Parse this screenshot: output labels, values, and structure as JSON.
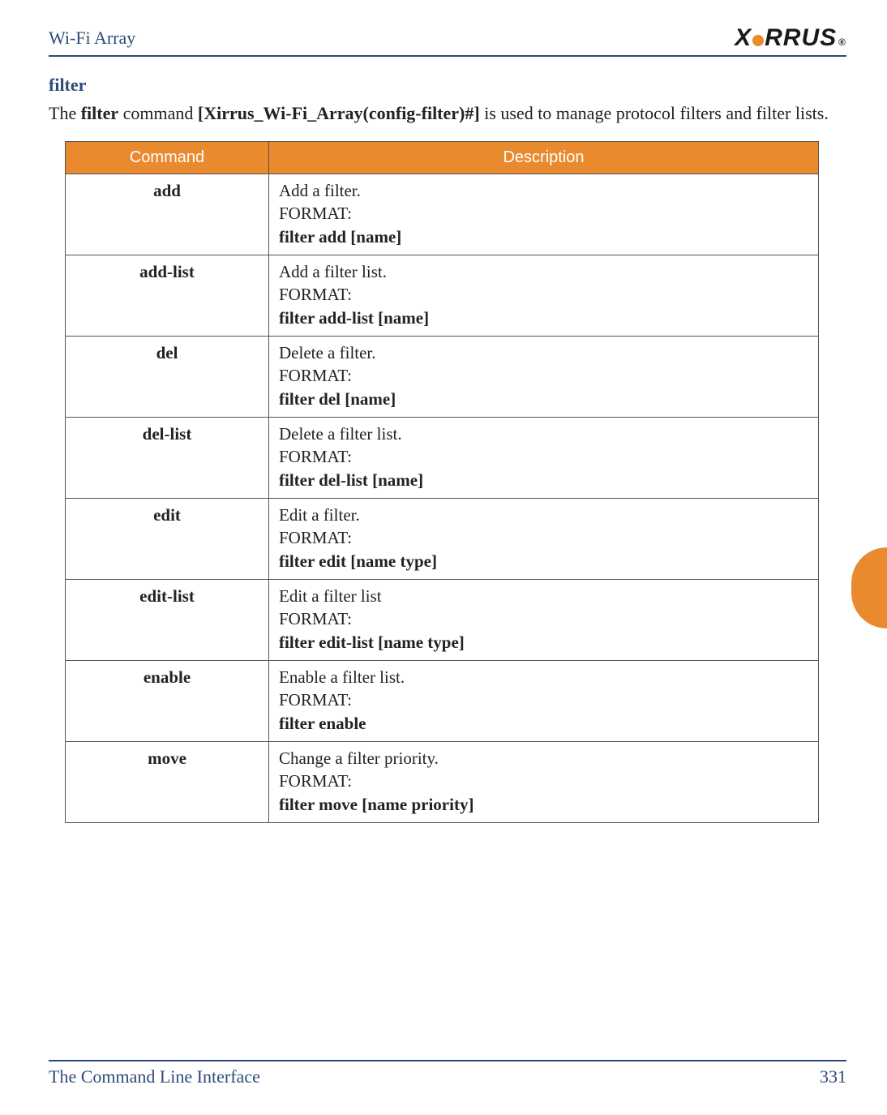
{
  "header": {
    "running_title": "Wi-Fi Array",
    "logo_text_left": "X",
    "logo_text_right": "RRUS",
    "logo_reg": "®"
  },
  "section": {
    "title": "filter",
    "intro_pre": "The ",
    "intro_bold1": "filter",
    "intro_mid": " command ",
    "intro_bold2": "[Xirrus_Wi-Fi_Array(config-filter)#]",
    "intro_post": " is used to manage protocol filters and filter lists."
  },
  "table": {
    "headers": {
      "command": "Command",
      "description": "Description"
    },
    "rows": [
      {
        "cmd": "add",
        "desc": "Add a filter.",
        "format_label": "FORMAT:",
        "format": "filter add [name]"
      },
      {
        "cmd": "add-list",
        "desc": "Add a filter list.",
        "format_label": "FORMAT:",
        "format": "filter add-list [name]"
      },
      {
        "cmd": "del",
        "desc": "Delete a filter.",
        "format_label": "FORMAT:",
        "format": "filter del [name]"
      },
      {
        "cmd": "del-list",
        "desc": "Delete a filter list.",
        "format_label": "FORMAT:",
        "format": "filter del-list [name]"
      },
      {
        "cmd": "edit",
        "desc": "Edit a filter.",
        "format_label": "FORMAT:",
        "format": "filter edit [name type]"
      },
      {
        "cmd": "edit-list",
        "desc": "Edit a filter list",
        "format_label": "FORMAT:",
        "format": "filter edit-list [name type]"
      },
      {
        "cmd": "enable",
        "desc": "Enable a filter list.",
        "format_label": "FORMAT:",
        "format": "filter enable"
      },
      {
        "cmd": "move",
        "desc": "Change a filter priority.",
        "format_label": "FORMAT:",
        "format": "filter move [name priority]"
      }
    ]
  },
  "footer": {
    "chapter": "The Command Line Interface",
    "page": "331"
  }
}
